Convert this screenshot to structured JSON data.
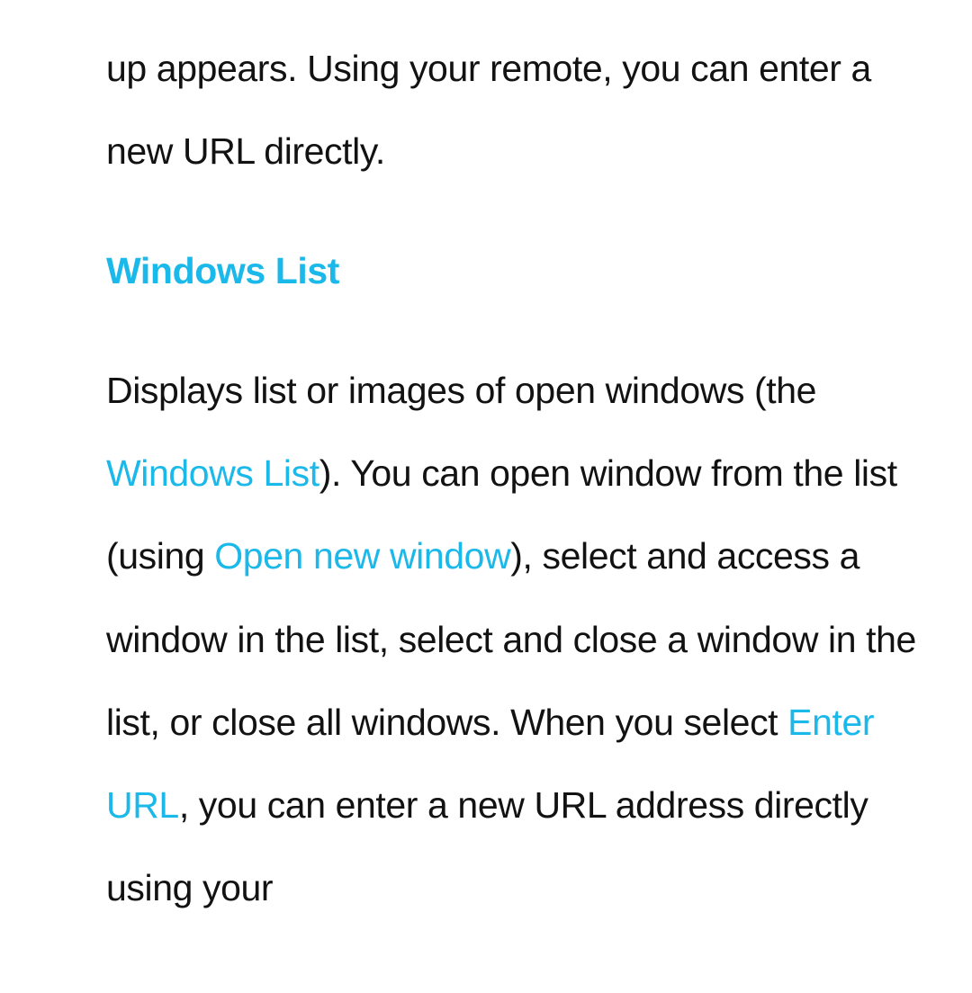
{
  "intro": {
    "text": "up appears. Using your remote, you can enter a new URL directly."
  },
  "heading": "Windows List",
  "body": {
    "part1": "Displays list or images of open windows (the ",
    "highlight1": "Windows List",
    "part2": "). You can open window from the list (using ",
    "highlight2": "Open new window",
    "part3": "), select and access a window in the list, select and close a window in the list, or close all windows. When you select ",
    "highlight3": "Enter URL",
    "part4": ", you can enter a new URL address directly using your"
  }
}
